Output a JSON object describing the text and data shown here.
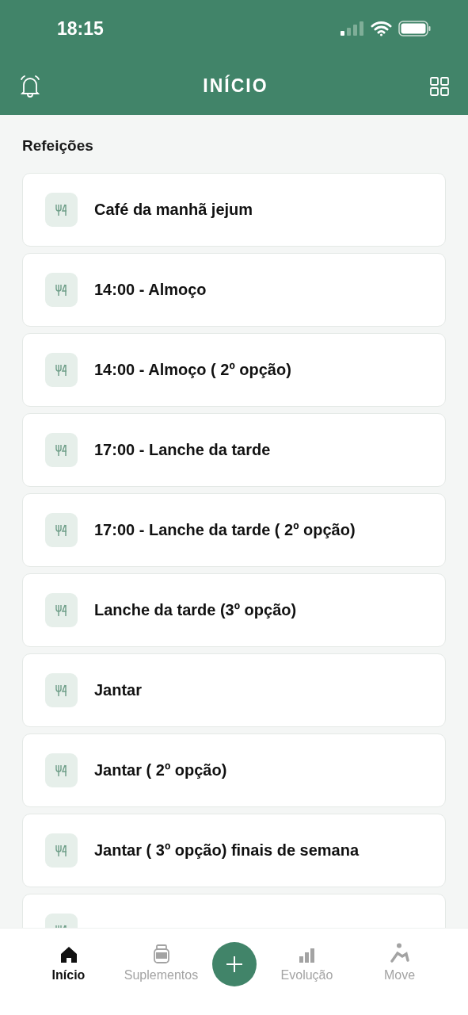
{
  "status_bar": {
    "time": "18:15"
  },
  "header": {
    "title": "INÍCIO"
  },
  "section": {
    "title": "Refeições"
  },
  "meals": [
    {
      "title": "Café da manhã jejum"
    },
    {
      "title": "14:00 - Almoço"
    },
    {
      "title": "14:00 - Almoço ( 2º opção)"
    },
    {
      "title": "17:00 - Lanche da tarde"
    },
    {
      "title": "17:00 - Lanche da tarde ( 2º opção)"
    },
    {
      "title": "Lanche da tarde (3º opção)"
    },
    {
      "title": "Jantar"
    },
    {
      "title": "Jantar ( 2º opção)"
    },
    {
      "title": "Jantar ( 3º opção) finais de semana"
    }
  ],
  "more_below": true,
  "bottom_nav": [
    {
      "kind": "home",
      "label": "Início",
      "selected": true
    },
    {
      "kind": "supplements",
      "label": "Suplementos",
      "selected": false
    },
    {
      "kind": "add"
    },
    {
      "kind": "chart",
      "label": "Evolução",
      "selected": false
    },
    {
      "kind": "move",
      "label": "Move",
      "selected": false
    }
  ]
}
